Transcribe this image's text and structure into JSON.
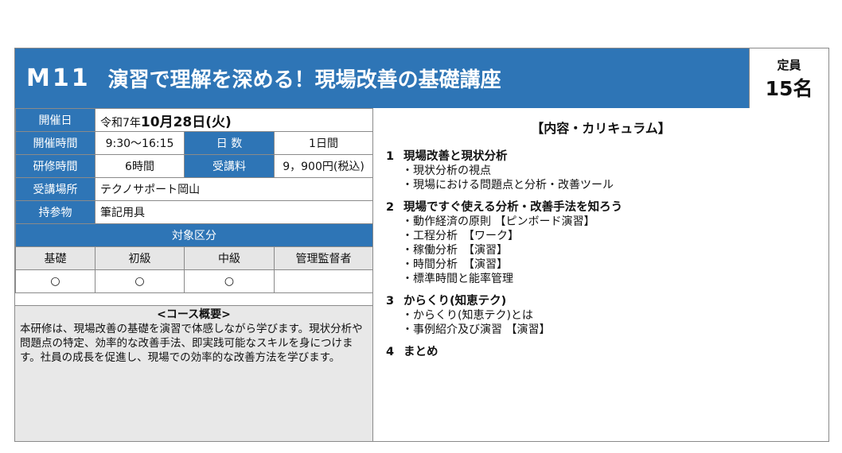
{
  "header": {
    "code": "M11",
    "title": "演習で理解を深める！現場改善の基礎講座"
  },
  "capacity": {
    "label": "定員",
    "value": "15名"
  },
  "info": {
    "date_label": "開催日",
    "date_prefix": "令和7年",
    "date_main": "10月28日(火)",
    "time_label": "開催時間",
    "time_value": "9:30～16:15",
    "days_label": "日 数",
    "days_value": "1日間",
    "hours_label": "研修時間",
    "hours_value": "6時間",
    "fee_label": "受講料",
    "fee_value": "9，900円(税込)",
    "place_label": "受講場所",
    "place_value": "テクノサポート岡山",
    "bring_label": "持参物",
    "bring_value": "筆記用具"
  },
  "target": {
    "label": "対象区分",
    "levels": [
      "基礎",
      "初級",
      "中級",
      "管理監督者"
    ],
    "marks": [
      "○",
      "○",
      "○",
      ""
    ]
  },
  "summary": {
    "heading": "<コース概要>",
    "body": "本研修は、現場改善の基礎を演習で体感しながら学びます。現状分析や問題点の特定、効率的な改善手法、即実践可能なスキルを身につけます。社員の成長を促進し、現場での効率的な改善方法を学びます。"
  },
  "curriculum": {
    "heading": "【内容・カリキュラム】",
    "items": [
      {
        "num": "1",
        "title": "現場改善と現状分析",
        "subs": [
          "現状分析の視点",
          "現場における問題点と分析・改善ツール"
        ]
      },
      {
        "num": "2",
        "title": "現場ですぐ使える分析・改善手法を知ろう",
        "subs": [
          "動作経済の原則 【ピンボード演習】",
          "工程分析　【ワーク】",
          "稼働分析　【演習】",
          "時間分析　【演習】",
          "標準時間と能率管理"
        ]
      },
      {
        "num": "3",
        "title": "からくり(知恵テク)",
        "subs": [
          "からくり(知恵テク)とは",
          "事例紹介及び演習 【演習】"
        ]
      },
      {
        "num": "4",
        "title": "まとめ",
        "subs": []
      }
    ]
  },
  "colors": {
    "accent": "#2e75b6",
    "summary_bg": "#e8e8e8"
  }
}
